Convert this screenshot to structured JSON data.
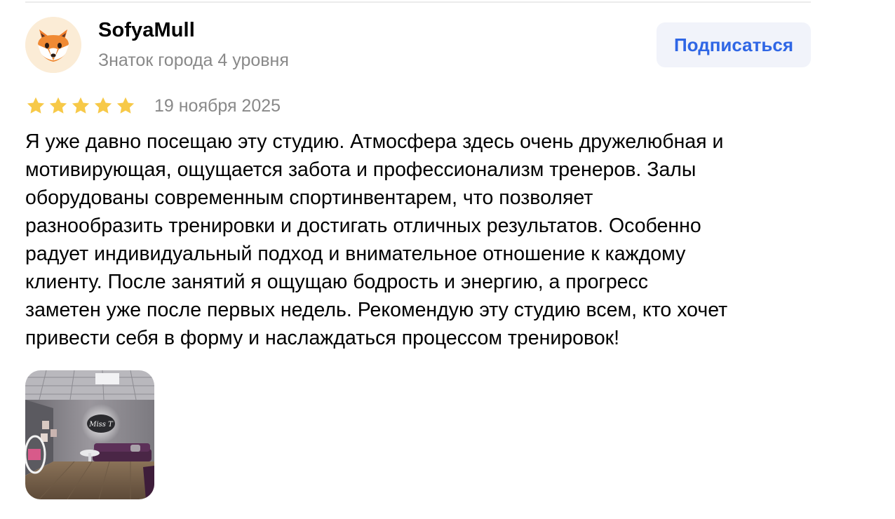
{
  "review": {
    "author": {
      "name": "SofyaMull",
      "level": "Знаток города 4 уровня",
      "avatar_icon": "fox-icon"
    },
    "subscribe_label": "Подписаться",
    "rating": 5,
    "rating_max": 5,
    "date": "19 ноября 2025",
    "text_lines": [
      "Я уже давно посещаю эту студию. Атмосфера здесь очень дружелюбная и",
      "мотивирующая, ощущается забота и профессионализм тренеров. Залы",
      "оборудованы современным спортинвентарем, что позволяет",
      "разнообразить тренировки и достигать отличных результатов. Особенно",
      "радует индивидуальный подход и внимательное отношение к каждому",
      "клиенту. После занятий я ощущаю бодрость и энергию, а прогресс",
      "заметен уже после первых недель. Рекомендую эту студию всем, кто хочет",
      "привести себя в форму и наслаждаться процессом тренировок!"
    ],
    "photo": {
      "sign_text": "Miss T"
    }
  },
  "colors": {
    "accent": "#2f66e5",
    "button_bg": "#f1f3fa",
    "star": "#f7c948",
    "muted_text": "#898989",
    "divider": "#ebebeb"
  }
}
